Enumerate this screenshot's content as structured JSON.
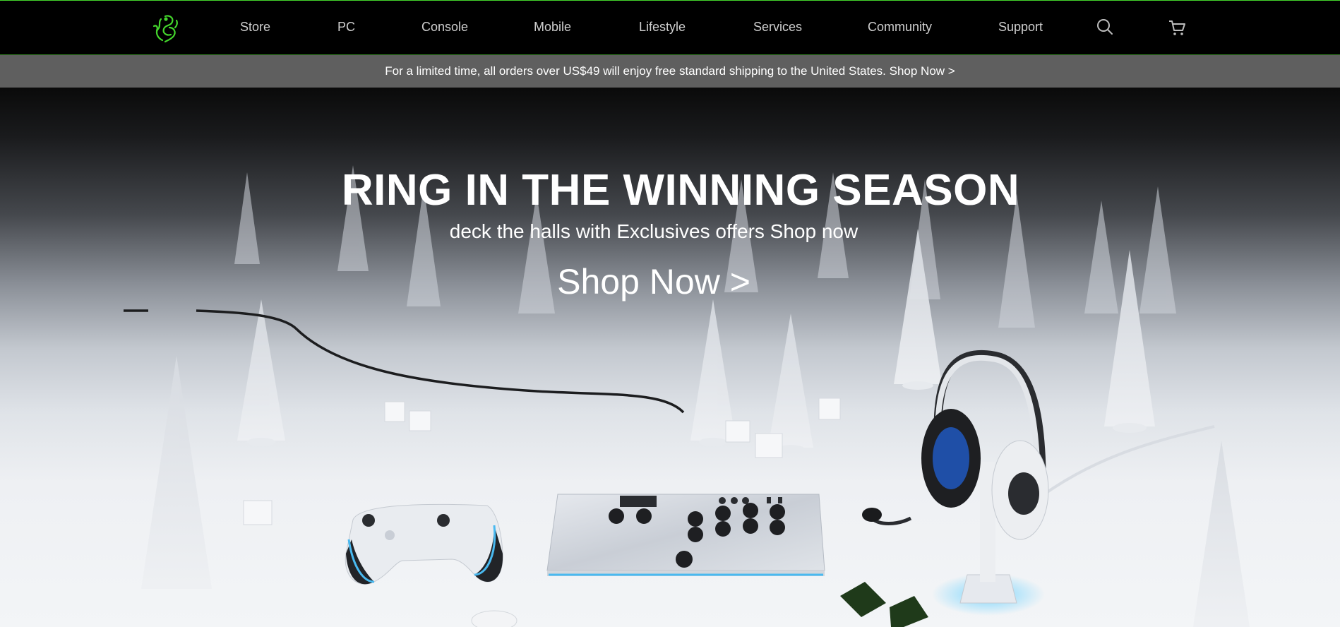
{
  "nav": {
    "logo": "razer-snake-logo",
    "items": [
      {
        "label": "Store"
      },
      {
        "label": "PC"
      },
      {
        "label": "Console"
      },
      {
        "label": "Mobile"
      },
      {
        "label": "Lifestyle"
      },
      {
        "label": "Services"
      },
      {
        "label": "Community"
      },
      {
        "label": "Support"
      }
    ],
    "icons": [
      "search-icon",
      "cart-icon"
    ],
    "accent_color": "#44d62c"
  },
  "promo": {
    "text": "For a limited time, all orders over US$49 will enjoy free standard shipping to the United States. Shop Now >"
  },
  "hero": {
    "title": "RING IN THE WINNING SEASON",
    "subtitle": "deck the halls with Exclusives offers Shop now",
    "cta": "Shop Now >"
  }
}
